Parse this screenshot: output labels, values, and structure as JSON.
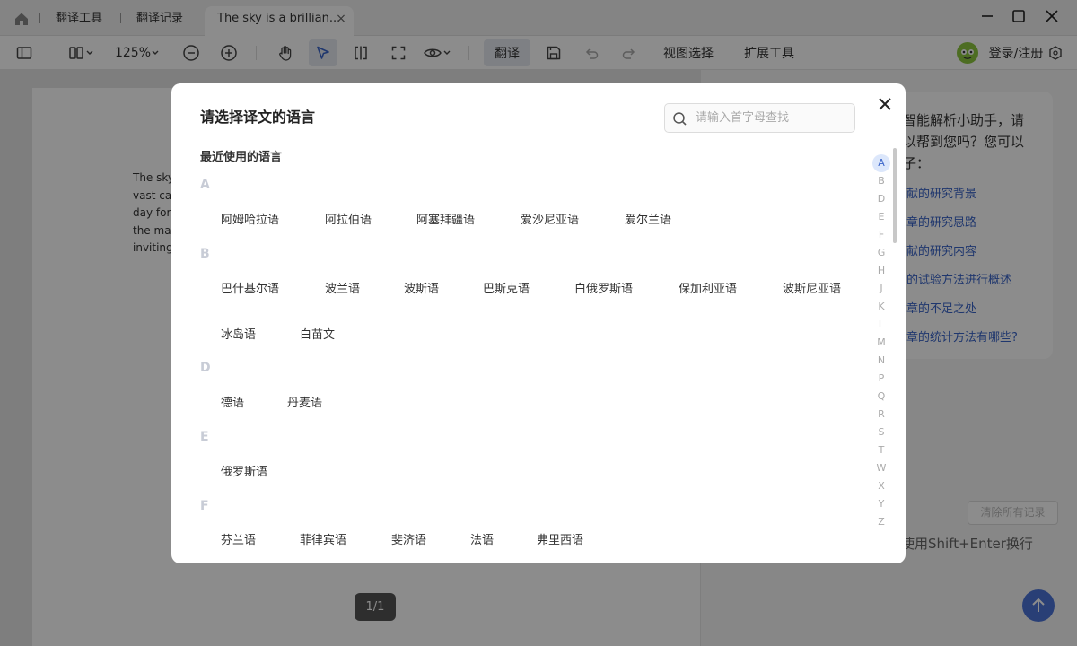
{
  "titlebar": {
    "tabs": [
      "翻译工具",
      "翻译记录"
    ],
    "active_tab": "The sky is a brillian...",
    "tab_close": "×"
  },
  "toolbar": {
    "zoom": "125%",
    "translate_label": "翻译",
    "view_select_label": "视图选择",
    "extension_label": "扩展工具",
    "login_label": "登录/注册"
  },
  "document": {
    "lines": [
      "The sky",
      "vast can",
      "day for v",
      "the maj",
      "inviting"
    ],
    "page_indicator": "1/1"
  },
  "assistant": {
    "intro_lines": [
      "智能解析小助手，请",
      "以帮到您吗？您可以",
      "子："
    ],
    "suggestions": [
      "献的研究背景",
      "章的研究思路",
      "献的研究内容",
      "的试验方法进行概述",
      "章的不足之处",
      "章的统计方法有哪些?"
    ],
    "clear_label": "清除所有记录",
    "input_hint": "使用Shift+Enter换行"
  },
  "modal": {
    "title": "请选择译文的语言",
    "search_placeholder": "请输入首字母查找",
    "recent_label": "最近使用的语言",
    "sections": [
      {
        "letter": "A",
        "languages": [
          "阿姆哈拉语",
          "阿拉伯语",
          "阿塞拜疆语",
          "爱沙尼亚语",
          "爱尔兰语"
        ]
      },
      {
        "letter": "B",
        "languages": [
          "巴什基尔语",
          "波兰语",
          "波斯语",
          "巴斯克语",
          "白俄罗斯语",
          "保加利亚语",
          "波斯尼亚语",
          "冰岛语",
          "白苗文"
        ]
      },
      {
        "letter": "D",
        "languages": [
          "德语",
          "丹麦语"
        ]
      },
      {
        "letter": "E",
        "languages": [
          "俄罗斯语"
        ]
      },
      {
        "letter": "F",
        "languages": [
          "芬兰语",
          "菲律宾语",
          "斐济语",
          "法语",
          "弗里西语"
        ]
      }
    ],
    "alphabet": [
      "A",
      "B",
      "D",
      "E",
      "F",
      "G",
      "H",
      "J",
      "K",
      "L",
      "M",
      "N",
      "P",
      "Q",
      "R",
      "S",
      "T",
      "W",
      "X",
      "Y",
      "Z"
    ],
    "active_letter": "A"
  }
}
